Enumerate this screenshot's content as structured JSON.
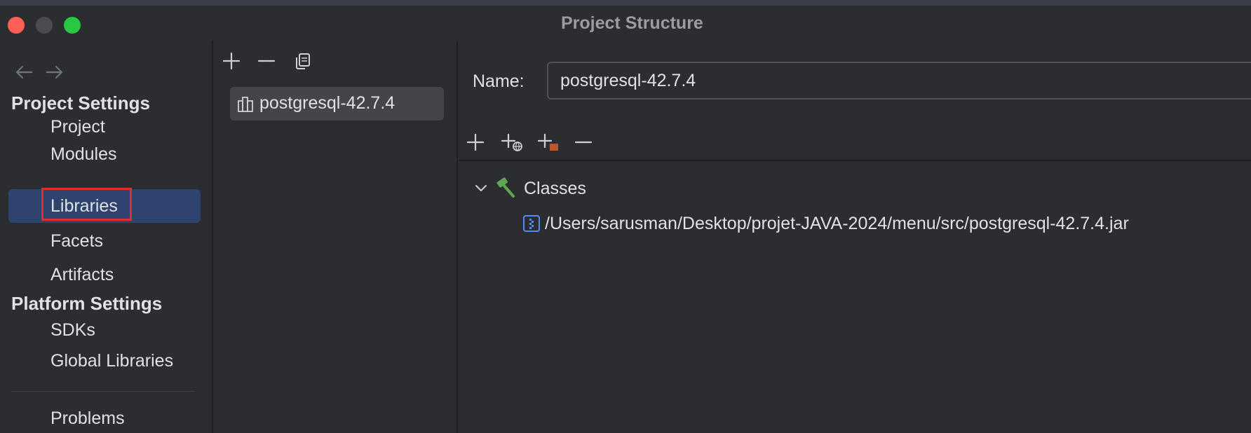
{
  "window": {
    "title": "Project Structure"
  },
  "sidebar": {
    "project_settings_header": "Project Settings",
    "project_items": [
      {
        "label": "Project"
      },
      {
        "label": "Modules"
      },
      {
        "label": "Libraries",
        "selected": true
      },
      {
        "label": "Facets"
      },
      {
        "label": "Artifacts"
      }
    ],
    "platform_settings_header": "Platform Settings",
    "platform_items": [
      {
        "label": "SDKs"
      },
      {
        "label": "Global Libraries"
      }
    ],
    "problems_label": "Problems"
  },
  "libraries_list": {
    "items": [
      {
        "label": "postgresql-42.7.4",
        "selected": true
      }
    ]
  },
  "detail": {
    "name_label": "Name:",
    "name_value": "postgresql-42.7.4",
    "tree": {
      "classes_label": "Classes",
      "expanded": true,
      "entries": [
        {
          "path": "/Users/sarusman/Desktop/projet-JAVA-2024/menu/src/postgresql-42.7.4.jar"
        }
      ]
    }
  },
  "colors": {
    "background": "#2b2d30",
    "selection": "#2e436e",
    "highlight_box": "#e02d2d",
    "classes_icon": "#5fa650"
  }
}
